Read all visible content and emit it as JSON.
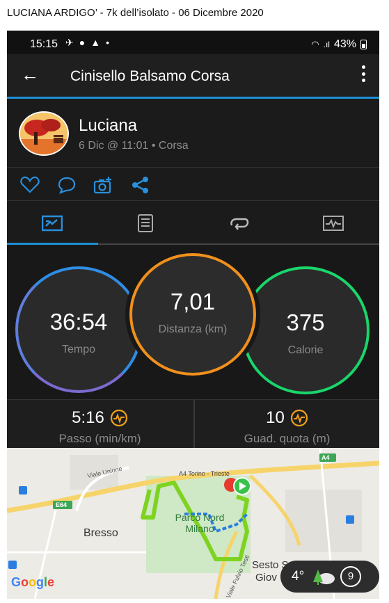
{
  "caption": "LUCIANA ARDIGO’  -  7k dell’isolato  -  06 Dicembre 2020",
  "status_bar": {
    "time": "15:15",
    "battery": "43%"
  },
  "app_bar": {
    "title": "Cinisello Balsamo Corsa"
  },
  "activity_header": {
    "user_name": "Luciana",
    "meta": "6 Dic @ 11:01 • Corsa"
  },
  "stats": {
    "time": {
      "value": "36:54",
      "label": "Tempo"
    },
    "distance": {
      "value": "7,01",
      "label": "Distanza (km)"
    },
    "calories": {
      "value": "375",
      "label": "Calorie"
    }
  },
  "secondary_stats": {
    "pace": {
      "value": "5:16",
      "label": "Passo (min/km)"
    },
    "elevation": {
      "value": "10",
      "label": "Guad. quota (m)"
    }
  },
  "map": {
    "labels": {
      "road_top": "Viale Unione",
      "highway": "A4 Torino - Trieste",
      "a4_badge": "A4",
      "e64_badge": "E64",
      "bresso": "Bresso",
      "park": "Parco Nord Milano",
      "viale_fulvio": "Viale Fulvio Testi",
      "sesto": "Sesto S",
      "giov": "Giov",
      "google": "Google"
    },
    "weather": {
      "temp": "4°",
      "count": "9"
    }
  },
  "colors": {
    "accent_blue": "#1c8fd6",
    "time_ring_start": "#2f8de4",
    "time_ring_end": "#7b6bd0",
    "distance_ring": "#f0901c",
    "calories_ring": "#19d66b",
    "pace_icon": "#f0a21c",
    "route_green": "#7ed321",
    "route_blue": "#2a7ee0"
  }
}
